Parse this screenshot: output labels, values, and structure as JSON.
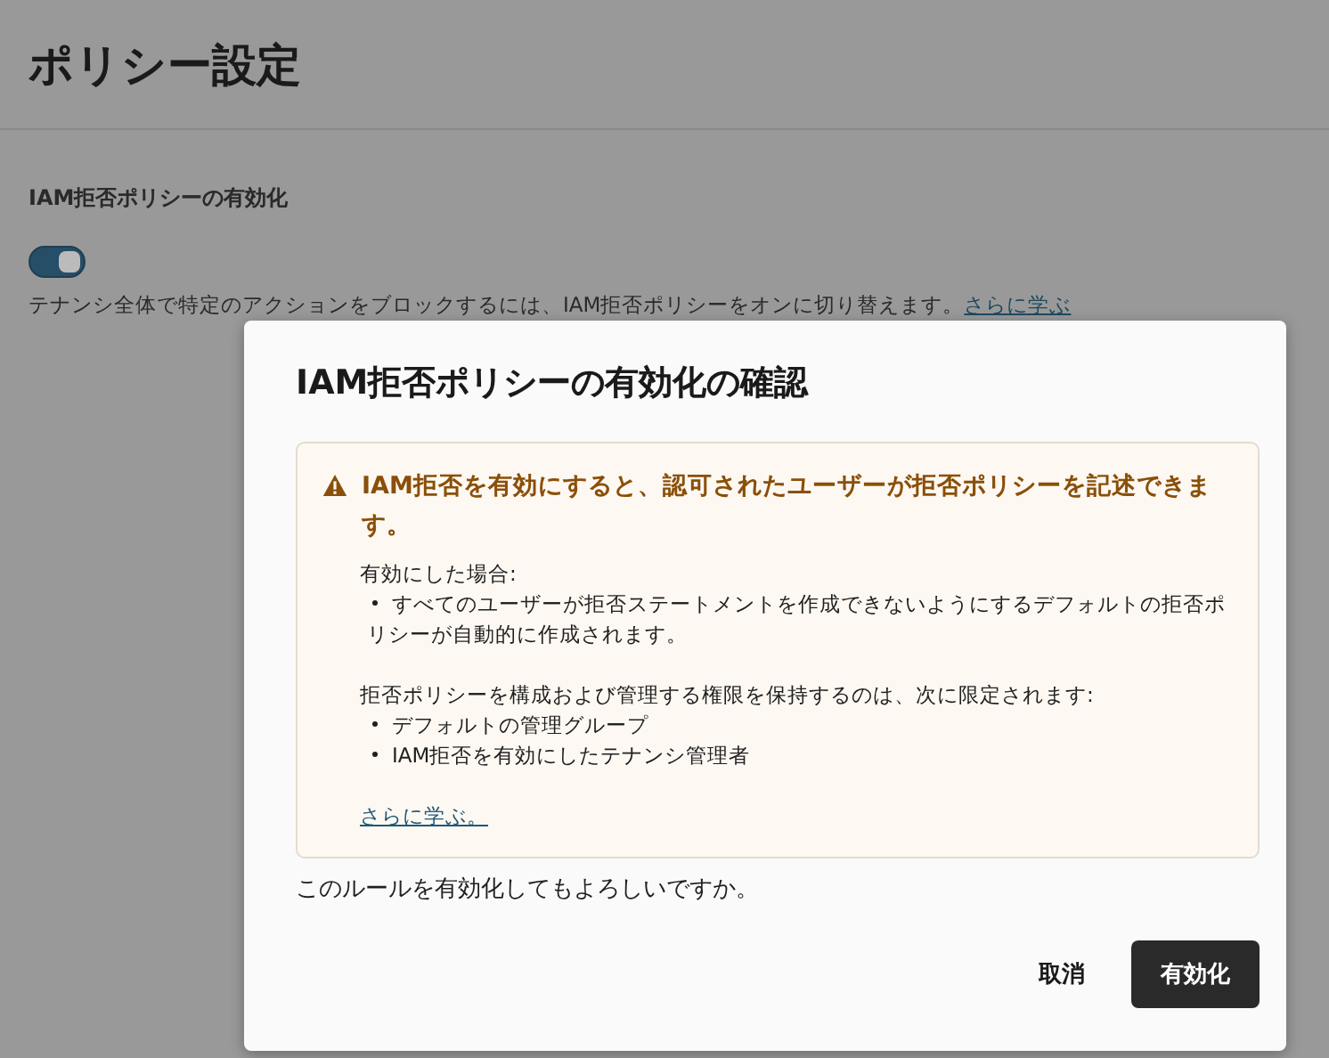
{
  "page": {
    "title": "ポリシー設定"
  },
  "setting": {
    "label": "IAM拒否ポリシーの有効化",
    "toggle": {
      "on": true
    },
    "description": "テナンシ全体で特定のアクションをブロックするには、IAM拒否ポリシーをオンに切り替えます。",
    "link": "さらに学ぶ"
  },
  "dialog": {
    "title": "IAM拒否ポリシーの有効化の確認",
    "warning": {
      "heading": "IAM拒否を有効にすると、認可されたユーザーが拒否ポリシーを記述できます。",
      "sections": [
        {
          "intro": "有効にした場合:",
          "bullets": [
            "すべてのユーザーが拒否ステートメントを作成できないようにするデフォルトの拒否ポリシーが自動的に作成されます。"
          ]
        },
        {
          "intro": "拒否ポリシーを構成および管理する権限を保持するのは、次に限定されます:",
          "bullets": [
            "デフォルトの管理グループ",
            "IAM拒否を有効にしたテナンシ管理者"
          ]
        }
      ],
      "link": "さらに学ぶ。"
    },
    "question": "このルールを有効化してもよろしいですか。",
    "buttons": [
      {
        "label": "取消",
        "kind": "secondary"
      },
      {
        "label": "有効化",
        "kind": "primary"
      }
    ]
  }
}
